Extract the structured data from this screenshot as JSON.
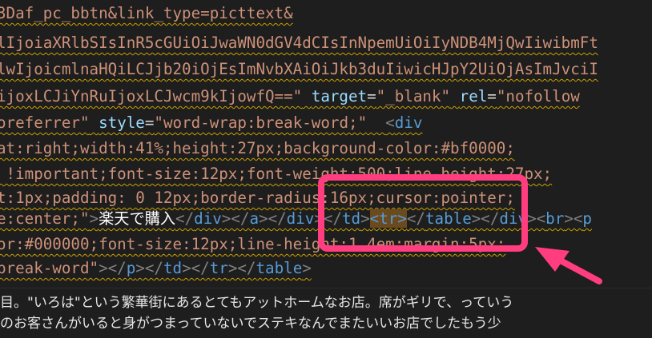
{
  "editor": {
    "lines": [
      [
        {
          "c": "tok-str",
          "t": "3Daf_pc_bbtn&link_type=picttext&"
        }
      ],
      [
        {
          "c": "tok-str",
          "t": "lIjoiaXRlbSIsInR5cGUiOiJwaWN0dGV4dCIsInNpemUiOiIyNDB4MjQwIiwibmFt"
        }
      ],
      [
        {
          "c": "tok-str",
          "t": "lwIjoicmlnaHQiLCJjb20iOjEsImNvbXAiOiJkb3duIiwicHJpY2UiOjAsImJvciI"
        }
      ],
      [
        {
          "c": "tok-str",
          "t": "ijoxLCJiYnRuIjoxLCJwcm9kIjowfQ==\""
        },
        {
          "c": "tok-eq",
          "t": " "
        },
        {
          "c": "tok-attr",
          "t": "target"
        },
        {
          "c": "tok-eq",
          "t": "="
        },
        {
          "c": "tok-str",
          "t": "\"_blank\""
        },
        {
          "c": "tok-eq",
          "t": " "
        },
        {
          "c": "tok-attr",
          "t": "rel"
        },
        {
          "c": "tok-eq",
          "t": "="
        },
        {
          "c": "tok-str",
          "t": "\"nofollow"
        }
      ],
      [
        {
          "c": "tok-str",
          "t": "oreferrer\""
        },
        {
          "c": "tok-eq",
          "t": " "
        },
        {
          "c": "tok-attr",
          "t": "style"
        },
        {
          "c": "tok-eq",
          "t": "="
        },
        {
          "c": "tok-str",
          "t": "\"word-wrap:break-word;\""
        },
        {
          "c": "tok-eq",
          "t": "  "
        },
        {
          "c": "tok-punc",
          "t": "<"
        },
        {
          "c": "tok-tag",
          "t": "div"
        }
      ],
      [
        {
          "c": "tok-str",
          "t": "at:right;width:41%;height:27px;background-color:#bf0000;"
        }
      ],
      [
        {
          "c": "tok-str",
          "t": " !important;font-size:12px;font-weight:500;line-height:27px;"
        }
      ],
      [
        {
          "c": "tok-str",
          "t": "t:1px;padding: 0 12px;border-radius:16px;cursor:pointer;"
        }
      ],
      [
        {
          "c": "tok-str",
          "t": "e:center;\""
        },
        {
          "c": "tok-punc",
          "t": ">"
        },
        {
          "c": "tok-text",
          "t": "楽天で購入"
        },
        {
          "c": "tok-punc",
          "t": "</"
        },
        {
          "c": "tok-tag",
          "t": "div"
        },
        {
          "c": "tok-punc",
          "t": "></"
        },
        {
          "c": "tok-tag",
          "t": "a"
        },
        {
          "c": "tok-punc",
          "t": "></"
        },
        {
          "c": "tok-tag",
          "t": "div"
        },
        {
          "c": "tok-punc",
          "t": "></"
        },
        {
          "c": "tok-tag",
          "t": "td"
        },
        {
          "c": "tok-punc",
          "t": ">"
        },
        {
          "c": "tok-hl",
          "t": "<tr>"
        },
        {
          "c": "tok-punc",
          "t": "</"
        },
        {
          "c": "tok-tag",
          "t": "table"
        },
        {
          "c": "tok-punc",
          "t": "></"
        },
        {
          "c": "tok-tag",
          "t": "div"
        },
        {
          "c": "tok-punc",
          "t": "><"
        },
        {
          "c": "tok-tag",
          "t": "br"
        },
        {
          "c": "tok-punc",
          "t": "><"
        },
        {
          "c": "tok-tag",
          "t": "p"
        }
      ],
      [
        {
          "c": "tok-str",
          "t": "or:#000000;font-size:12px;line-height:1.4em;margin:5px;"
        }
      ],
      [
        {
          "c": "tok-str",
          "t": "break-word\""
        },
        {
          "c": "tok-punc",
          "t": "></"
        },
        {
          "c": "tok-tag",
          "t": "p"
        },
        {
          "c": "tok-punc",
          "t": "></"
        },
        {
          "c": "tok-tag",
          "t": "td"
        },
        {
          "c": "tok-punc",
          "t": "></"
        },
        {
          "c": "tok-tag",
          "t": "tr"
        },
        {
          "c": "tok-punc",
          "t": "></"
        },
        {
          "c": "tok-tag",
          "t": "table"
        },
        {
          "c": "tok-punc",
          "t": ">"
        }
      ]
    ]
  },
  "preview": {
    "line1": "目。\"いろは\"という繁華街にあるとてもアットホームなお店。席がギリで、っていう",
    "line2": "のお客さんがいると身がつまっていないでステキなんでまたいいお店でしたもう少"
  },
  "colors": {
    "annotation": "#ff3d7f",
    "squiggle": "#c9a000"
  }
}
